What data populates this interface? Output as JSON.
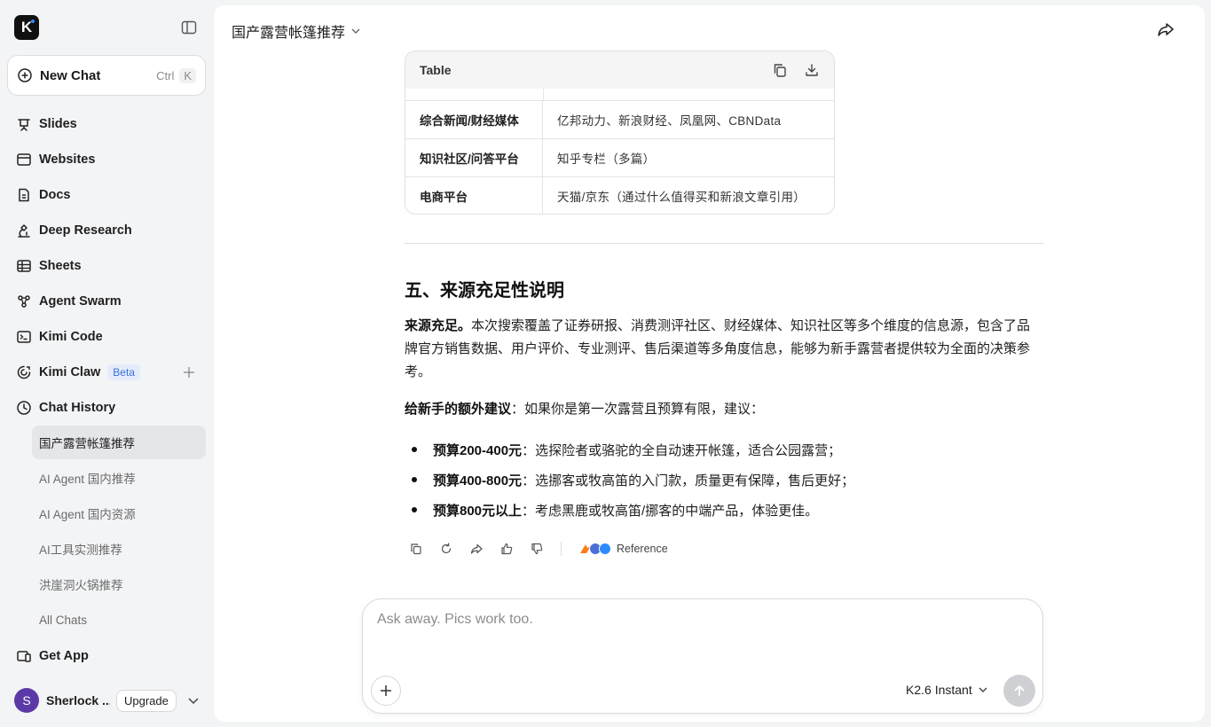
{
  "sidebar": {
    "logo_letter": "K",
    "new_chat": {
      "label": "New Chat",
      "shortcut_ctrl": "Ctrl",
      "shortcut_key": "K"
    },
    "nav": [
      {
        "label": "Slides",
        "icon": "slides-icon"
      },
      {
        "label": "Websites",
        "icon": "browser-icon"
      },
      {
        "label": "Docs",
        "icon": "docs-icon"
      },
      {
        "label": "Deep Research",
        "icon": "microscope-icon"
      },
      {
        "label": "Sheets",
        "icon": "table-icon"
      },
      {
        "label": "Agent Swarm",
        "icon": "swarm-icon"
      },
      {
        "label": "Kimi Code",
        "icon": "terminal-icon"
      },
      {
        "label": "Kimi Claw",
        "icon": "claw-icon",
        "badge": "Beta"
      },
      {
        "label": "Chat History",
        "icon": "clock-icon"
      }
    ],
    "history": [
      {
        "label": "国产露营帐篷推荐",
        "active": true
      },
      {
        "label": "AI Agent 国内推荐"
      },
      {
        "label": "AI Agent 国内资源"
      },
      {
        "label": "AI工具实测推荐"
      },
      {
        "label": "洪崖洞火锅推荐"
      },
      {
        "label": "All Chats"
      }
    ],
    "get_app": "Get App",
    "user": {
      "initial": "S",
      "name": "Sherlock ...",
      "upgrade": "Upgrade"
    }
  },
  "header": {
    "title": "国产露营帐篷推荐"
  },
  "table": {
    "title": "Table",
    "rows": [
      {
        "type": "综合新闻/财经媒体",
        "source": "亿邦动力、新浪财经、凤凰网、CBNData"
      },
      {
        "type": "知识社区/问答平台",
        "source": "知乎专栏（多篇）"
      },
      {
        "type": "电商平台",
        "source": "天猫/京东（通过什么值得买和新浪文章引用）"
      }
    ]
  },
  "article": {
    "heading": "五、来源充足性说明",
    "p1_bold": "来源充足。",
    "p1_rest": "本次搜索覆盖了证券研报、消费测评社区、财经媒体、知识社区等多个维度的信息源，包含了品牌官方销售数据、用户评价、专业测评、售后渠道等多角度信息，能够为新手露营者提供较为全面的决策参考。",
    "p2_bold": "给新手的额外建议",
    "p2_rest": "：如果你是第一次露营且预算有限，建议：",
    "bullets": [
      {
        "bold": "预算200-400元",
        "rest": "：选探险者或骆驼的全自动速开帐篷，适合公园露营；"
      },
      {
        "bold": "预算400-800元",
        "rest": "：选挪客或牧高笛的入门款，质量更有保障，售后更好；"
      },
      {
        "bold": "预算800元以上",
        "rest": "：考虑黑鹿或牧高笛/挪客的中端产品，体验更佳。"
      }
    ]
  },
  "actions": {
    "reference_label": "Reference"
  },
  "composer": {
    "placeholder": "Ask away. Pics work too.",
    "model": "K2.6 Instant"
  },
  "colors": {
    "avatar": "#5b3aa8",
    "beta_text": "#3b6fd8",
    "accent_blue": "#2f8cff"
  }
}
